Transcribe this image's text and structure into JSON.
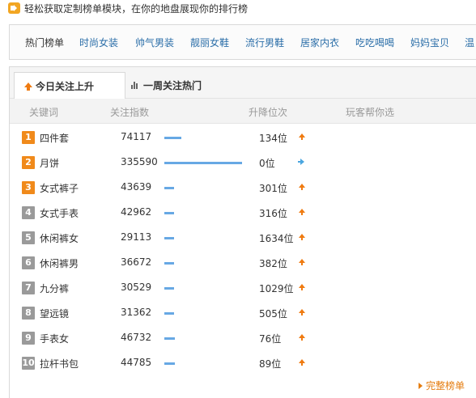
{
  "header": {
    "icon": "speaker-icon",
    "text": "轻松获取定制榜单模块，在你的地盘展现你的排行榜"
  },
  "nav": {
    "items": [
      "热门榜单",
      "时尚女装",
      "帅气男装",
      "靓丽女鞋",
      "流行男鞋",
      "居家内衣",
      "吃吃喝喝",
      "妈妈宝贝",
      "温"
    ]
  },
  "tabs": [
    {
      "label": "今日关注上升",
      "icon": "arrow-up-icon"
    },
    {
      "label": "一周关注热门",
      "icon": "bar-chart-icon"
    }
  ],
  "columns": {
    "keyword": "关键词",
    "index": "关注指数",
    "change": "升降位次",
    "help": "玩客帮你选"
  },
  "rows": [
    {
      "rank": "1",
      "keyword": "四件套",
      "index": "74117",
      "index_value": 74117,
      "change": "134位",
      "trend": "up"
    },
    {
      "rank": "2",
      "keyword": "月饼",
      "index": "335590",
      "index_value": 335590,
      "change": "0位",
      "trend": "flat"
    },
    {
      "rank": "3",
      "keyword": "女式裤子",
      "index": "43639",
      "index_value": 43639,
      "change": "301位",
      "trend": "up"
    },
    {
      "rank": "4",
      "keyword": "女式手表",
      "index": "42962",
      "index_value": 42962,
      "change": "316位",
      "trend": "up"
    },
    {
      "rank": "5",
      "keyword": "休闲裤女",
      "index": "29113",
      "index_value": 29113,
      "change": "1634位",
      "trend": "up"
    },
    {
      "rank": "6",
      "keyword": "休闲裤男",
      "index": "36672",
      "index_value": 36672,
      "change": "382位",
      "trend": "up"
    },
    {
      "rank": "7",
      "keyword": "九分裤",
      "index": "30529",
      "index_value": 30529,
      "change": "1029位",
      "trend": "up"
    },
    {
      "rank": "8",
      "keyword": "望远镜",
      "index": "31362",
      "index_value": 31362,
      "change": "505位",
      "trend": "up"
    },
    {
      "rank": "9",
      "keyword": "手表女",
      "index": "46732",
      "index_value": 46732,
      "change": "76位",
      "trend": "up"
    },
    {
      "rank": "10",
      "keyword": "拉杆书包",
      "index": "44785",
      "index_value": 44785,
      "change": "89位",
      "trend": "up"
    }
  ],
  "more_link": "完整榜单",
  "colors": {
    "accent": "#ef7b11",
    "link": "#2b6ea8",
    "bar": "#67a8e4",
    "rank_hot": "#f08a1b",
    "rank_cold": "#9a9a9a"
  }
}
